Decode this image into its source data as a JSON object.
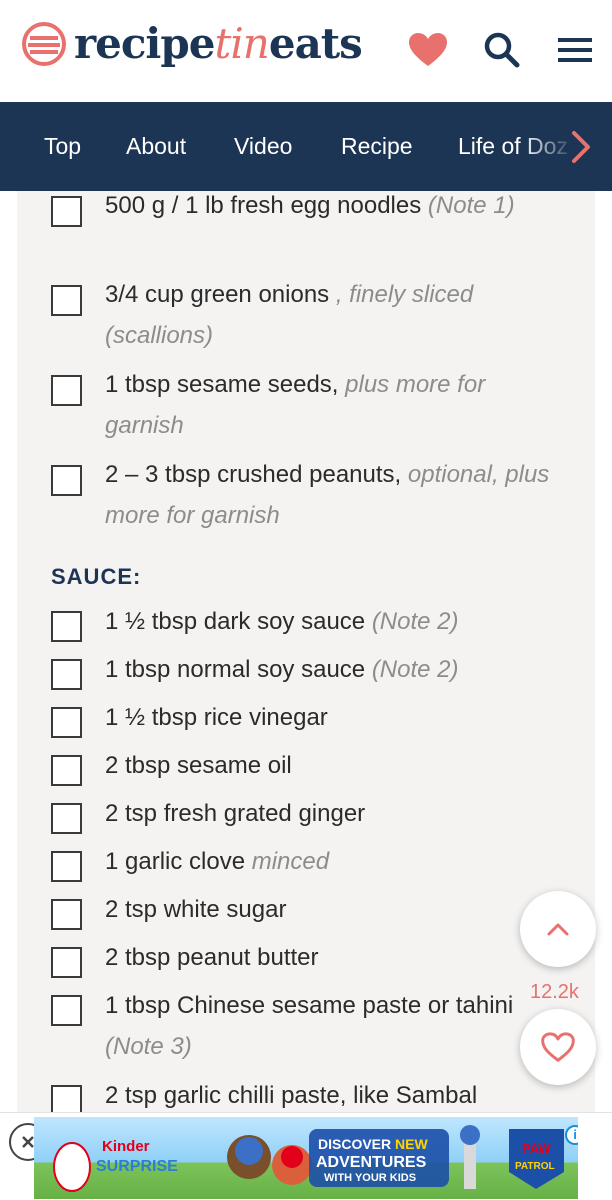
{
  "header": {
    "logo_prefix": "recipe",
    "logo_middle": "tin",
    "logo_suffix": "eats",
    "icons": [
      "heart-icon",
      "search-icon",
      "hamburger-menu-icon"
    ],
    "accent_color": "#e8716e",
    "brand_color": "#1c3554"
  },
  "nav": {
    "items": [
      "Top",
      "About",
      "Video",
      "Recipe",
      "Life of Doz"
    ],
    "more_icon": "chevron-right-icon"
  },
  "ingredients_top": [
    {
      "text": "500 g / 1 lb fresh egg noodles ",
      "note": "(Note 1)"
    },
    {
      "text": "3/4 cup green onions",
      "note": " , finely sliced (scallions)"
    },
    {
      "text": "1 tbsp sesame seeds, ",
      "note": "plus more for garnish"
    },
    {
      "text": "2 – 3 tbsp crushed peanuts, ",
      "note": "optional, plus more for garnish"
    }
  ],
  "sauce": {
    "heading": "SAUCE:",
    "items": [
      {
        "text": "1 ½ tbsp dark soy sauce ",
        "note": "(Note 2)"
      },
      {
        "text": "1 tbsp normal soy sauce ",
        "note": "(Note 2)"
      },
      {
        "text": "1 ½ tbsp rice vinegar",
        "note": ""
      },
      {
        "text": "2 tbsp sesame oil",
        "note": ""
      },
      {
        "text": "2 tsp fresh grated ginger",
        "note": ""
      },
      {
        "text": "1 garlic clove ",
        "note": "minced"
      },
      {
        "text": "2 tsp white sugar",
        "note": ""
      },
      {
        "text": "2 tbsp peanut butter",
        "note": ""
      },
      {
        "text": "1 tbsp Chinese sesame paste or tahini ",
        "note": "(Note 3)"
      },
      {
        "text": "2 tsp garlic chilli paste, like Sambal",
        "note": ""
      }
    ]
  },
  "floating": {
    "scroll_top_icon": "chevron-up-icon",
    "save_count": "12.2k",
    "save_icon": "heart-outline-icon"
  },
  "ad": {
    "close_icon": "close-icon",
    "info_icon": "info-icon",
    "brand": "Kinder",
    "brand_sub": "SURPRISE",
    "headline": "DISCOVER NEW ADVENTURES WITH YOUR KIDS",
    "headline_new": "NEW",
    "partner_a": "PAW",
    "partner_b": "PATROL"
  }
}
